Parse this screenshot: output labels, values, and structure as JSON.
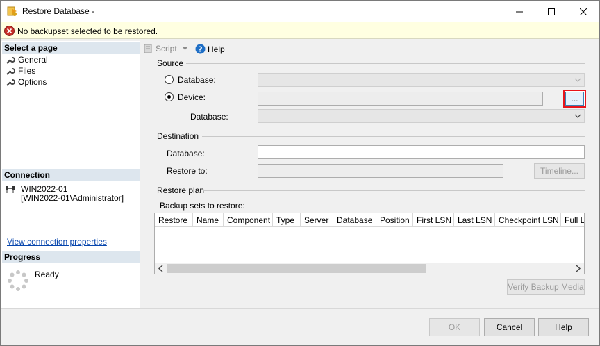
{
  "window": {
    "title": "Restore Database -"
  },
  "error": {
    "message": "No backupset selected to be restored."
  },
  "left": {
    "select_page": "Select a page",
    "pages": [
      "General",
      "Files",
      "Options"
    ],
    "connection": "Connection",
    "server": "WIN2022-01",
    "user": "[WIN2022-01\\Administrator]",
    "view_props": "View connection properties",
    "progress": "Progress",
    "status": "Ready"
  },
  "toolbar": {
    "script": "Script",
    "help": "Help"
  },
  "source": {
    "label": "Source",
    "database_radio": "Database:",
    "device_radio": "Device:",
    "device_value": "",
    "browse": "...",
    "database_sub": "Database:"
  },
  "destination": {
    "label": "Destination",
    "database": "Database:",
    "database_value": "",
    "restore_to": "Restore to:",
    "restore_to_value": "",
    "timeline": "Timeline..."
  },
  "plan": {
    "label": "Restore plan",
    "sets_label": "Backup sets to restore:",
    "columns": [
      "Restore",
      "Name",
      "Component",
      "Type",
      "Server",
      "Database",
      "Position",
      "First LSN",
      "Last LSN",
      "Checkpoint LSN",
      "Full LS"
    ],
    "verify": "Verify Backup Media"
  },
  "footer": {
    "ok": "OK",
    "cancel": "Cancel",
    "help": "Help"
  }
}
